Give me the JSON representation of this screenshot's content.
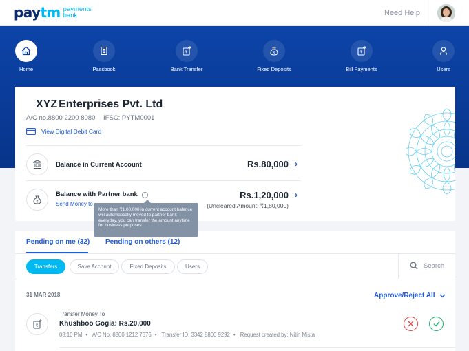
{
  "header": {
    "logo_pay": "pay",
    "logo_tm": "tm",
    "logo_sub_1": "payments",
    "logo_sub_2": "bank",
    "need_help": "Need Help"
  },
  "nav": {
    "items": [
      {
        "label": "Home",
        "icon": "home-icon",
        "active": true
      },
      {
        "label": "Passbook",
        "icon": "passbook-icon"
      },
      {
        "label": "Bank Transfer",
        "icon": "bank-transfer-icon"
      },
      {
        "label": "Fixed Deposits",
        "icon": "fixed-deposits-icon"
      },
      {
        "label": "Bill Payments",
        "icon": "bill-payments-icon"
      },
      {
        "label": "Users",
        "icon": "users-icon"
      }
    ]
  },
  "account": {
    "company_prefix": "XYZ",
    "company_name": "Enterprises Pvt. Ltd",
    "ac_no": "A/C no.8800 2200 8080",
    "ifsc": "IFSC: PYTM0001",
    "view_card": "View Digital Debit Card",
    "current_label": "Balance in Current Account",
    "current_amount": "Rs.80,000",
    "partner_label": "Balance with Partner bank",
    "partner_amount": "Rs.1,20,000",
    "send_money": "Send Money to",
    "uncleared": "(Uncleared Amount: ₹1,80,000)",
    "tooltip": "More than ₹1,00,000 in current account balance will automatically moved to partner bank everyday, you can transfer the amount anytime for business purposes"
  },
  "pending": {
    "tab_me": "Pending on me (32)",
    "tab_others": "Pending on others (12)",
    "chips": [
      "Transfers",
      "Save Account",
      "Fixed Deposits",
      "Users"
    ],
    "search": "Search",
    "date": "31 MAR 2018",
    "approve_all": "Approve/Reject All",
    "tx": {
      "title": "Transfer Money To",
      "name": "Khushboo Gogia: Rs.20,000",
      "time": "08:10 PM",
      "ac": "A/C No. 8800 1212 7676",
      "transfer_id": "Transfer ID: 3342 8800 9292",
      "created_by": "Request created by: Nitin Mista"
    }
  },
  "colors": {
    "brand_navy": "#0b2b6e",
    "brand_cyan": "#00b9f1",
    "nav_blue": "#0a3e9e",
    "link_blue": "#1e5ddb",
    "reject_red": "#e0474c",
    "approve_green": "#20b36b"
  }
}
